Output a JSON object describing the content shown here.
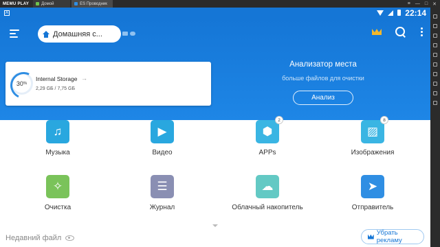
{
  "emulator": {
    "logo": "MEMU PLAY",
    "tabs": [
      {
        "label": "Домой"
      },
      {
        "label": "ES Проводник"
      }
    ],
    "controls": [
      "≡",
      "—",
      "□",
      "✕"
    ]
  },
  "statusbar": {
    "left_icon": "A",
    "time": "22:14"
  },
  "toolbar": {
    "breadcrumb": "Домашняя с..."
  },
  "storage": {
    "percent": "30",
    "percent_sign": "%",
    "name": "Internal Storage",
    "arrow": "→",
    "size": "2,29 GБ / 7,75 GБ"
  },
  "analyzer": {
    "title": "Анализатор места",
    "subtitle": "больше файлов для очистки",
    "button": "Анализ"
  },
  "grid": {
    "music": "Музыка",
    "video": "Видео",
    "apps": "APPs",
    "apps_badge": "2",
    "images": "Изображения",
    "images_badge": "8",
    "clean": "Очистка",
    "journal": "Журнал",
    "cloud": "Облачный накопитель",
    "sender": "Отправитель"
  },
  "recent": {
    "label": "Недавний файл"
  },
  "ads": {
    "label": "Убрать рекламу"
  },
  "colors": {
    "primary": "#1576d6",
    "music": "#29a7df",
    "video": "#29a7df",
    "apps": "#3ab5e3",
    "images": "#3ab5e3",
    "clean": "#7ac35a",
    "journal": "#8a8fb3",
    "cloud": "#63c9c4",
    "sender": "#2f8ee3",
    "crown": "#f5b82a"
  }
}
